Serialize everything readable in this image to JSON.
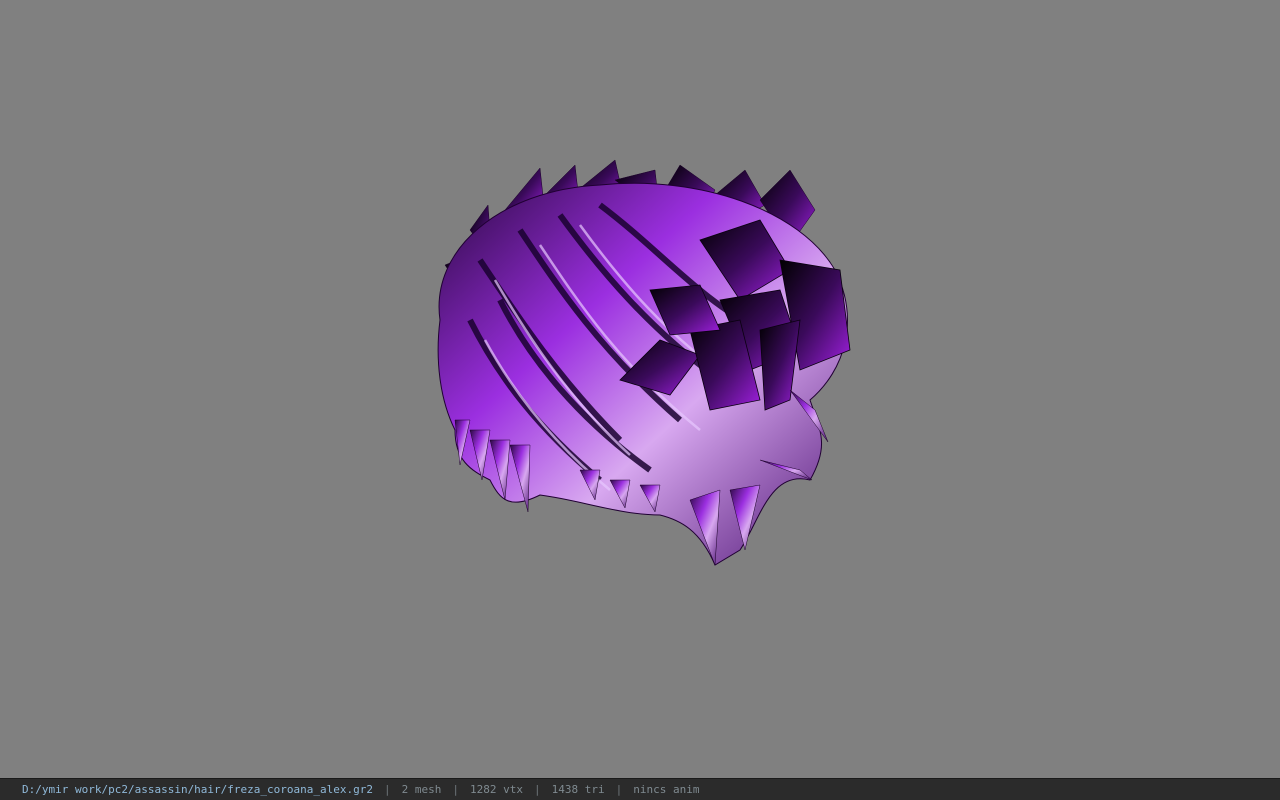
{
  "viewport": {
    "background_color": "#808080",
    "model_color": "#8a1fc7"
  },
  "status": {
    "file_path": "D:/ymir work/pc2/assassin/hair/freza_coroana_alex.gr2",
    "separator": "|",
    "mesh": "2 mesh",
    "vertices": "1282 vtx",
    "triangles": "1438 tri",
    "animation": "nincs anim"
  }
}
